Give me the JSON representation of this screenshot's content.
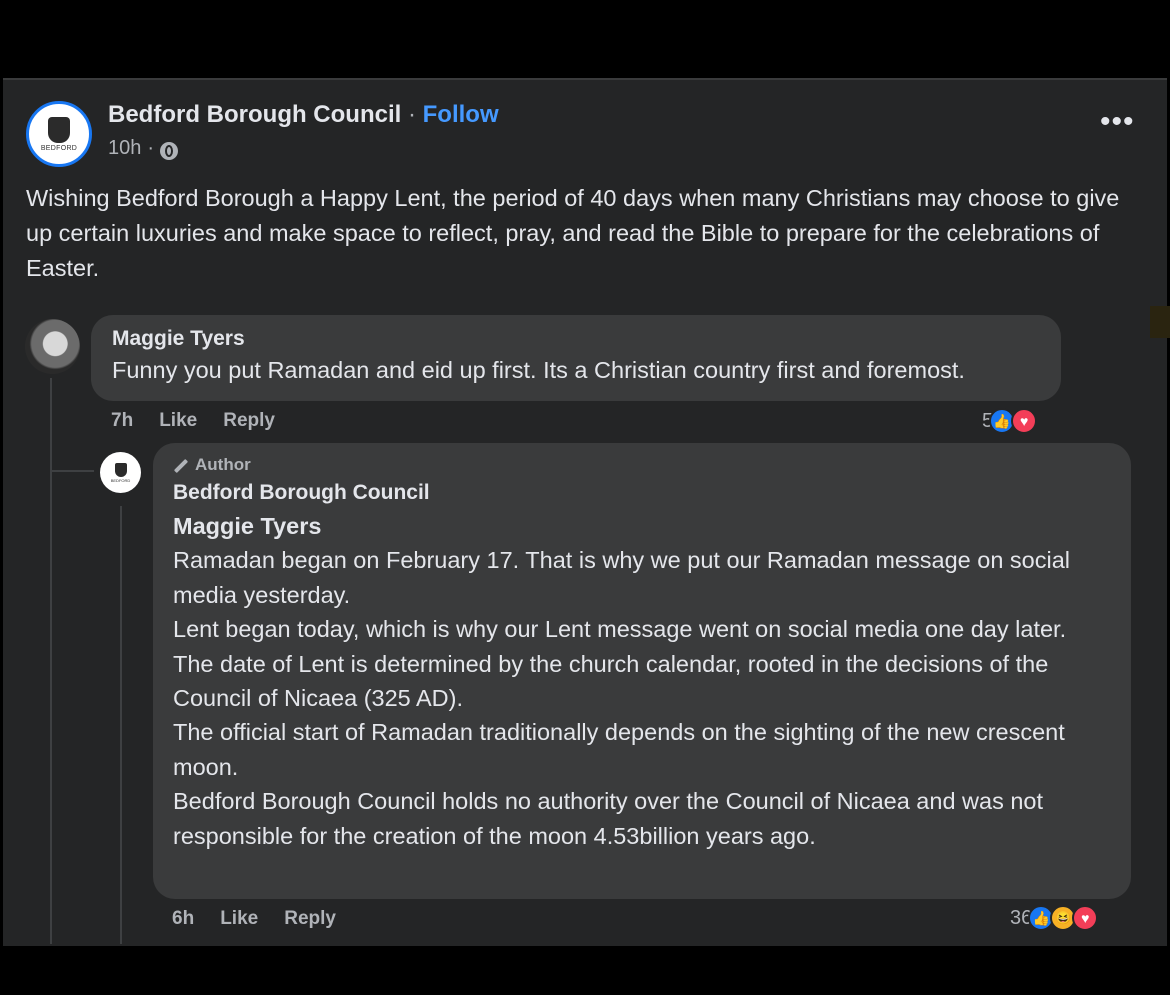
{
  "post": {
    "page_name": "Bedford Borough Council",
    "separator": "·",
    "follow_label": "Follow",
    "time": "10h",
    "meta_separator": "·",
    "avatar_text": "BEDFORD",
    "more_icon": "ellipsis-icon",
    "body": "Wishing Bedford Borough a Happy Lent, the period of 40 days when many Christians may choose to give up certain luxuries and make space to reflect, pray, and read the Bible to prepare for the celebrations of Easter."
  },
  "comments": [
    {
      "author": "Maggie Tyers",
      "text": "Funny you put Ramadan and eid up first. Its a Christian country first and foremost.",
      "time": "7h",
      "like_label": "Like",
      "reply_label": "Reply",
      "reaction_count": "5",
      "reactions": [
        "like-reaction-icon",
        "love-reaction-icon"
      ]
    }
  ],
  "reply": {
    "badge": "Author",
    "author": "Bedford Borough Council",
    "avatar_text": "BEDFORD",
    "mention": "Maggie Tyers",
    "lines": [
      "Ramadan began on February 17. That is why we put our Ramadan message on social media yesterday.",
      "Lent began today, which is why our Lent message went on social media one day later.",
      "The date of Lent is determined by the church calendar, rooted in the decisions of the Council of Nicaea (325 AD).",
      "The official start of Ramadan traditionally depends on the sighting of the new crescent moon.",
      "Bedford Borough Council holds no authority over the Council of Nicaea and was not responsible for the creation of the moon 4.53billion years ago."
    ],
    "time": "6h",
    "like_label": "Like",
    "reply_label": "Reply",
    "reaction_count": "36",
    "reactions": [
      "like-reaction-icon",
      "haha-reaction-icon",
      "love-reaction-icon"
    ]
  },
  "colors": {
    "background": "#000000",
    "card": "#242526",
    "bubble": "#3a3b3c",
    "link": "#4599ff",
    "like": "#1877f2",
    "love": "#f33e58"
  }
}
